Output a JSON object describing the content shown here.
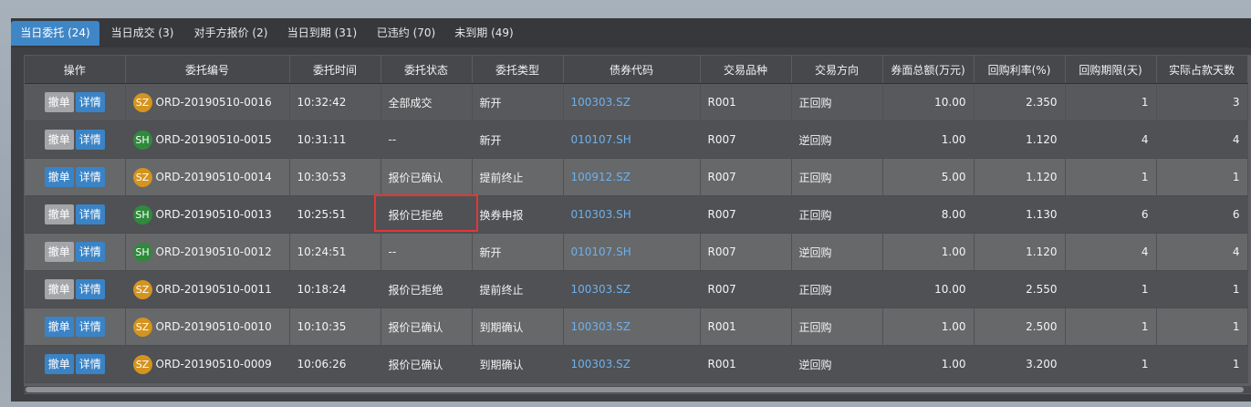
{
  "tabs": [
    {
      "label": "当日委托 (24)",
      "active": true
    },
    {
      "label": "当日成交 (3)",
      "active": false
    },
    {
      "label": "对手方报价 (2)",
      "active": false
    },
    {
      "label": "当日到期 (31)",
      "active": false
    },
    {
      "label": "已违约 (70)",
      "active": false
    },
    {
      "label": "未到期 (49)",
      "active": false
    }
  ],
  "table": {
    "headers": [
      "操作",
      "委托编号",
      "委托时间",
      "委托状态",
      "委托类型",
      "债券代码",
      "交易品种",
      "交易方向",
      "券面总额(万元)",
      "回购利率(%)",
      "回购期限(天)",
      "实际占款天数"
    ],
    "cancel_label": "撤单",
    "detail_label": "详情",
    "rows": [
      {
        "cancel_enabled": false,
        "exchange": "SZ",
        "order_id": "ORD-20190510-0016",
        "time": "10:32:42",
        "status": "全部成交",
        "type": "新开",
        "bond_code": "100303.SZ",
        "product": "R001",
        "direction": "正回购",
        "face_amount": "10.00",
        "rate": "2.350",
        "term": "1",
        "actual_days": "3"
      },
      {
        "cancel_enabled": false,
        "exchange": "SH",
        "order_id": "ORD-20190510-0015",
        "time": "10:31:11",
        "status": "--",
        "type": "新开",
        "bond_code": "010107.SH",
        "product": "R007",
        "direction": "逆回购",
        "face_amount": "1.00",
        "rate": "1.120",
        "term": "4",
        "actual_days": "4"
      },
      {
        "cancel_enabled": true,
        "exchange": "SZ",
        "order_id": "ORD-20190510-0014",
        "time": "10:30:53",
        "status": "报价已确认",
        "type": "提前终止",
        "bond_code": "100912.SZ",
        "product": "R007",
        "direction": "正回购",
        "face_amount": "5.00",
        "rate": "1.120",
        "term": "1",
        "actual_days": "1"
      },
      {
        "cancel_enabled": false,
        "exchange": "SH",
        "order_id": "ORD-20190510-0013",
        "time": "10:25:51",
        "status": "报价已拒绝",
        "type": "换券申报",
        "bond_code": "010303.SH",
        "product": "R007",
        "direction": "正回购",
        "face_amount": "8.00",
        "rate": "1.130",
        "term": "6",
        "actual_days": "6"
      },
      {
        "cancel_enabled": false,
        "exchange": "SH",
        "order_id": "ORD-20190510-0012",
        "time": "10:24:51",
        "status": "--",
        "type": "新开",
        "bond_code": "010107.SH",
        "product": "R007",
        "direction": "逆回购",
        "face_amount": "1.00",
        "rate": "1.120",
        "term": "4",
        "actual_days": "4"
      },
      {
        "cancel_enabled": false,
        "exchange": "SZ",
        "order_id": "ORD-20190510-0011",
        "time": "10:18:24",
        "status": "报价已拒绝",
        "type": "提前终止",
        "bond_code": "100303.SZ",
        "product": "R007",
        "direction": "正回购",
        "face_amount": "10.00",
        "rate": "2.550",
        "term": "1",
        "actual_days": "1"
      },
      {
        "cancel_enabled": true,
        "exchange": "SZ",
        "order_id": "ORD-20190510-0010",
        "time": "10:10:35",
        "status": "报价已确认",
        "type": "到期确认",
        "bond_code": "100303.SZ",
        "product": "R001",
        "direction": "正回购",
        "face_amount": "1.00",
        "rate": "2.500",
        "term": "1",
        "actual_days": "1"
      },
      {
        "cancel_enabled": true,
        "exchange": "SZ",
        "order_id": "ORD-20190510-0009",
        "time": "10:06:26",
        "status": "报价已确认",
        "type": "到期确认",
        "bond_code": "100303.SZ",
        "product": "R001",
        "direction": "逆回购",
        "face_amount": "1.00",
        "rate": "3.200",
        "term": "1",
        "actual_days": "1"
      }
    ]
  },
  "colors": {
    "accent": "#3f86c7",
    "highlight": "#e53636",
    "sz_badge": "#d4941f",
    "sh_badge": "#2f8a3c",
    "link": "#6fb0ec"
  }
}
